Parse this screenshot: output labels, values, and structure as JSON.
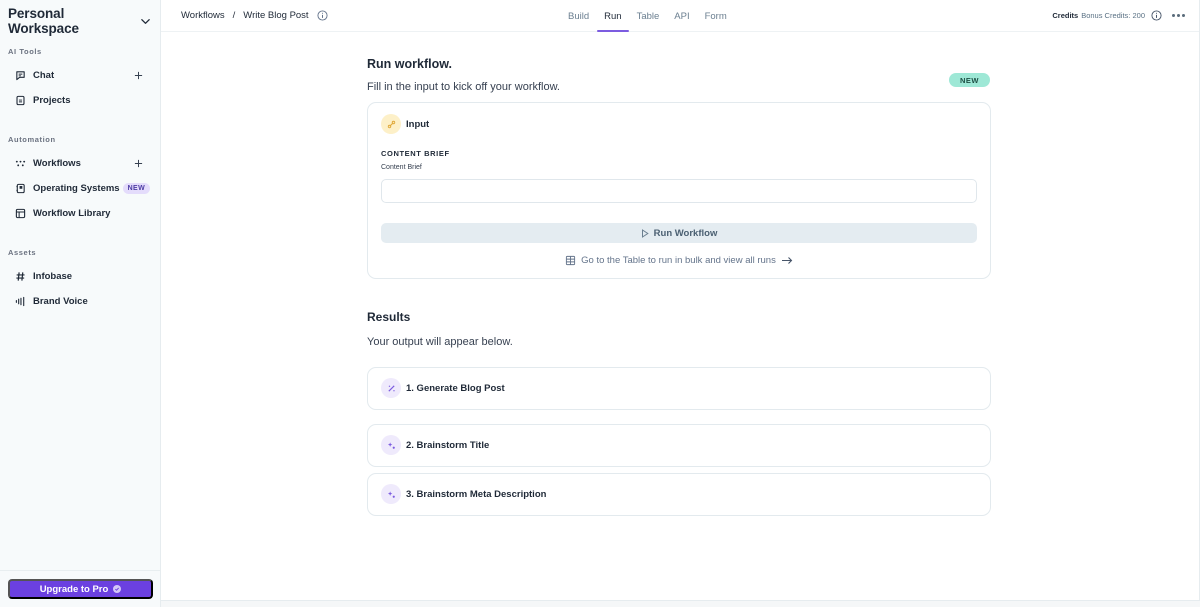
{
  "sidebar": {
    "workspace_name": "Personal Workspace",
    "sections": [
      {
        "label": "AI Tools",
        "items": [
          {
            "label": "Chat",
            "icon": "chat-bubble-icon",
            "has_add": true
          },
          {
            "label": "Projects",
            "icon": "document-icon",
            "has_add": false
          }
        ]
      },
      {
        "label": "Automation",
        "items": [
          {
            "label": "Workflows",
            "icon": "workflow-dots-icon",
            "has_add": true
          },
          {
            "label": "Operating Systems",
            "icon": "os-book-icon",
            "badge": "NEW"
          },
          {
            "label": "Workflow Library",
            "icon": "library-layout-icon"
          }
        ]
      },
      {
        "label": "Assets",
        "items": [
          {
            "label": "Infobase",
            "icon": "hash-icon"
          },
          {
            "label": "Brand Voice",
            "icon": "waveform-icon"
          }
        ]
      }
    ],
    "upgrade_label": "Upgrade to Pro"
  },
  "topbar": {
    "breadcrumb": [
      "Workflows",
      "Write Blog Post"
    ],
    "breadcrumb_separator": "/",
    "tabs": [
      {
        "label": "Build",
        "active": false
      },
      {
        "label": "Run",
        "active": true
      },
      {
        "label": "Table",
        "active": false
      },
      {
        "label": "API",
        "active": false
      },
      {
        "label": "Form",
        "active": false
      }
    ],
    "credits_label": "Credits",
    "credits_value": "Bonus Credits: 200"
  },
  "run": {
    "title": "Run workflow.",
    "subtitle": "Fill in the input to kick off your workflow.",
    "new_badge": "NEW",
    "input_card": {
      "title": "Input",
      "field_label": "CONTENT BRIEF",
      "field_sublabel": "Content Brief",
      "field_value": "",
      "field_placeholder": "",
      "run_button": "Run Workflow",
      "table_link": "Go to the Table to run in bulk and view all runs"
    }
  },
  "results": {
    "title": "Results",
    "subtitle": "Your output will appear below.",
    "steps": [
      {
        "label": "1. Generate Blog Post",
        "icon": "magic-wand-icon"
      },
      {
        "label": "2. Brainstorm Title",
        "icon": "sparkle-icon"
      },
      {
        "label": "3. Brainstorm Meta Description",
        "icon": "sparkle-icon"
      }
    ]
  },
  "colors": {
    "accent": "#6b40e0",
    "tab_underline": "#7c5ce0",
    "new_badge_bg": "#9ee8d6",
    "sidebar_badge_bg": "#e4dcfb"
  }
}
